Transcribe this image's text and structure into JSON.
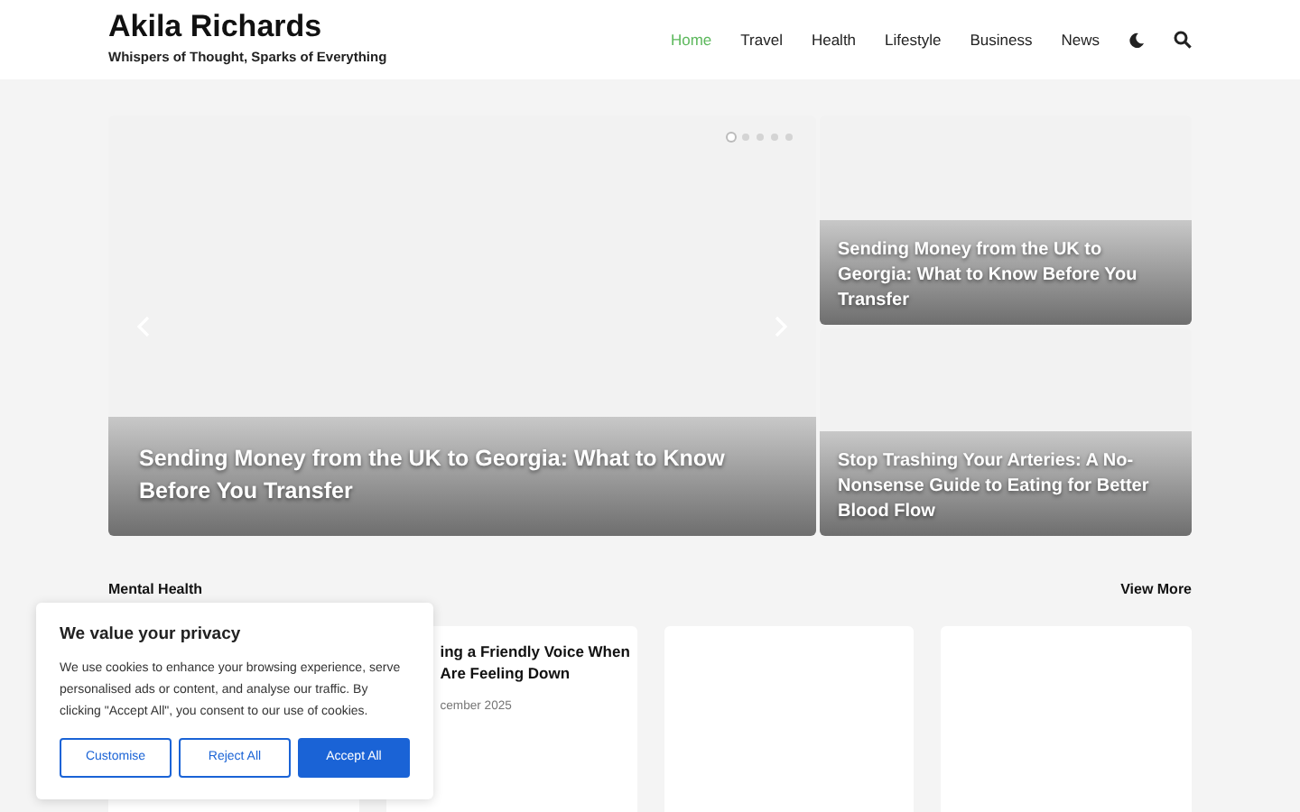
{
  "site": {
    "title": "Akila Richards",
    "tagline": "Whispers of Thought, Sparks of Everything"
  },
  "nav": [
    {
      "label": "Home",
      "selected": true
    },
    {
      "label": "Travel",
      "selected": false
    },
    {
      "label": "Health",
      "selected": false
    },
    {
      "label": "Lifestyle",
      "selected": false
    },
    {
      "label": "Business",
      "selected": false
    },
    {
      "label": "News",
      "selected": false
    }
  ],
  "slider": {
    "title": "Sending Money from the UK to Georgia: What to Know Before You Transfer",
    "dots": [
      {
        "selected": true
      },
      {
        "selected": false
      },
      {
        "selected": false
      },
      {
        "selected": false
      },
      {
        "selected": false
      }
    ]
  },
  "side_posts": [
    {
      "title": "Sending Money from the UK to Georgia: What to Know Before You Transfer"
    },
    {
      "title": "Stop Trashing Your Arteries: A No-Nonsense Guide to Eating for Better Blood Flow"
    }
  ],
  "section": {
    "title": "Mental Health",
    "link": "View More"
  },
  "cards": [
    {
      "kind": "blank"
    },
    {
      "kind": "post",
      "title_lines": [
        "ing a Friendly Voice When",
        "Are Feeling Down"
      ],
      "date": "cember 2025"
    },
    {
      "kind": "blank"
    },
    {
      "kind": "blank"
    }
  ],
  "cookie": {
    "title": "We value your privacy",
    "text": "We use cookies to enhance your browsing experience, serve personalised ads or content, and analyse our traffic. By clicking \"Accept All\", you consent to our use of cookies.",
    "buttons": [
      {
        "label": "Customise",
        "kind": "outline"
      },
      {
        "label": "Reject All",
        "kind": "outline"
      },
      {
        "label": "Accept All",
        "kind": "primary"
      }
    ]
  }
}
